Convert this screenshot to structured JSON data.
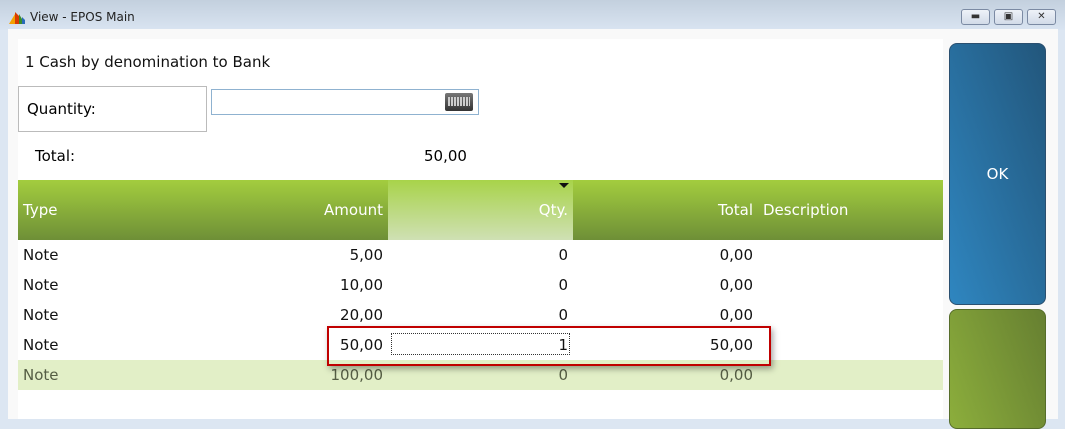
{
  "window": {
    "title": "View - EPOS Main"
  },
  "heading": "1 Cash by denomination to Bank",
  "quantity": {
    "label": "Quantity:",
    "value": ""
  },
  "total": {
    "label": "Total:",
    "value": "50,00"
  },
  "table": {
    "headers": {
      "type": "Type",
      "amount": "Amount",
      "qty": "Qty.",
      "total": "Total",
      "description": "Description"
    },
    "rows": [
      {
        "type": "Note",
        "amount": "5,00",
        "qty": "0",
        "total": "0,00"
      },
      {
        "type": "Note",
        "amount": "10,00",
        "qty": "0",
        "total": "0,00"
      },
      {
        "type": "Note",
        "amount": "20,00",
        "qty": "0",
        "total": "0,00"
      },
      {
        "type": "Note",
        "amount": "50,00",
        "qty": "1",
        "total": "50,00"
      },
      {
        "type": "Note",
        "amount": "100,00",
        "qty": "0",
        "total": "0,00"
      }
    ]
  },
  "buttons": {
    "ok": "OK"
  }
}
